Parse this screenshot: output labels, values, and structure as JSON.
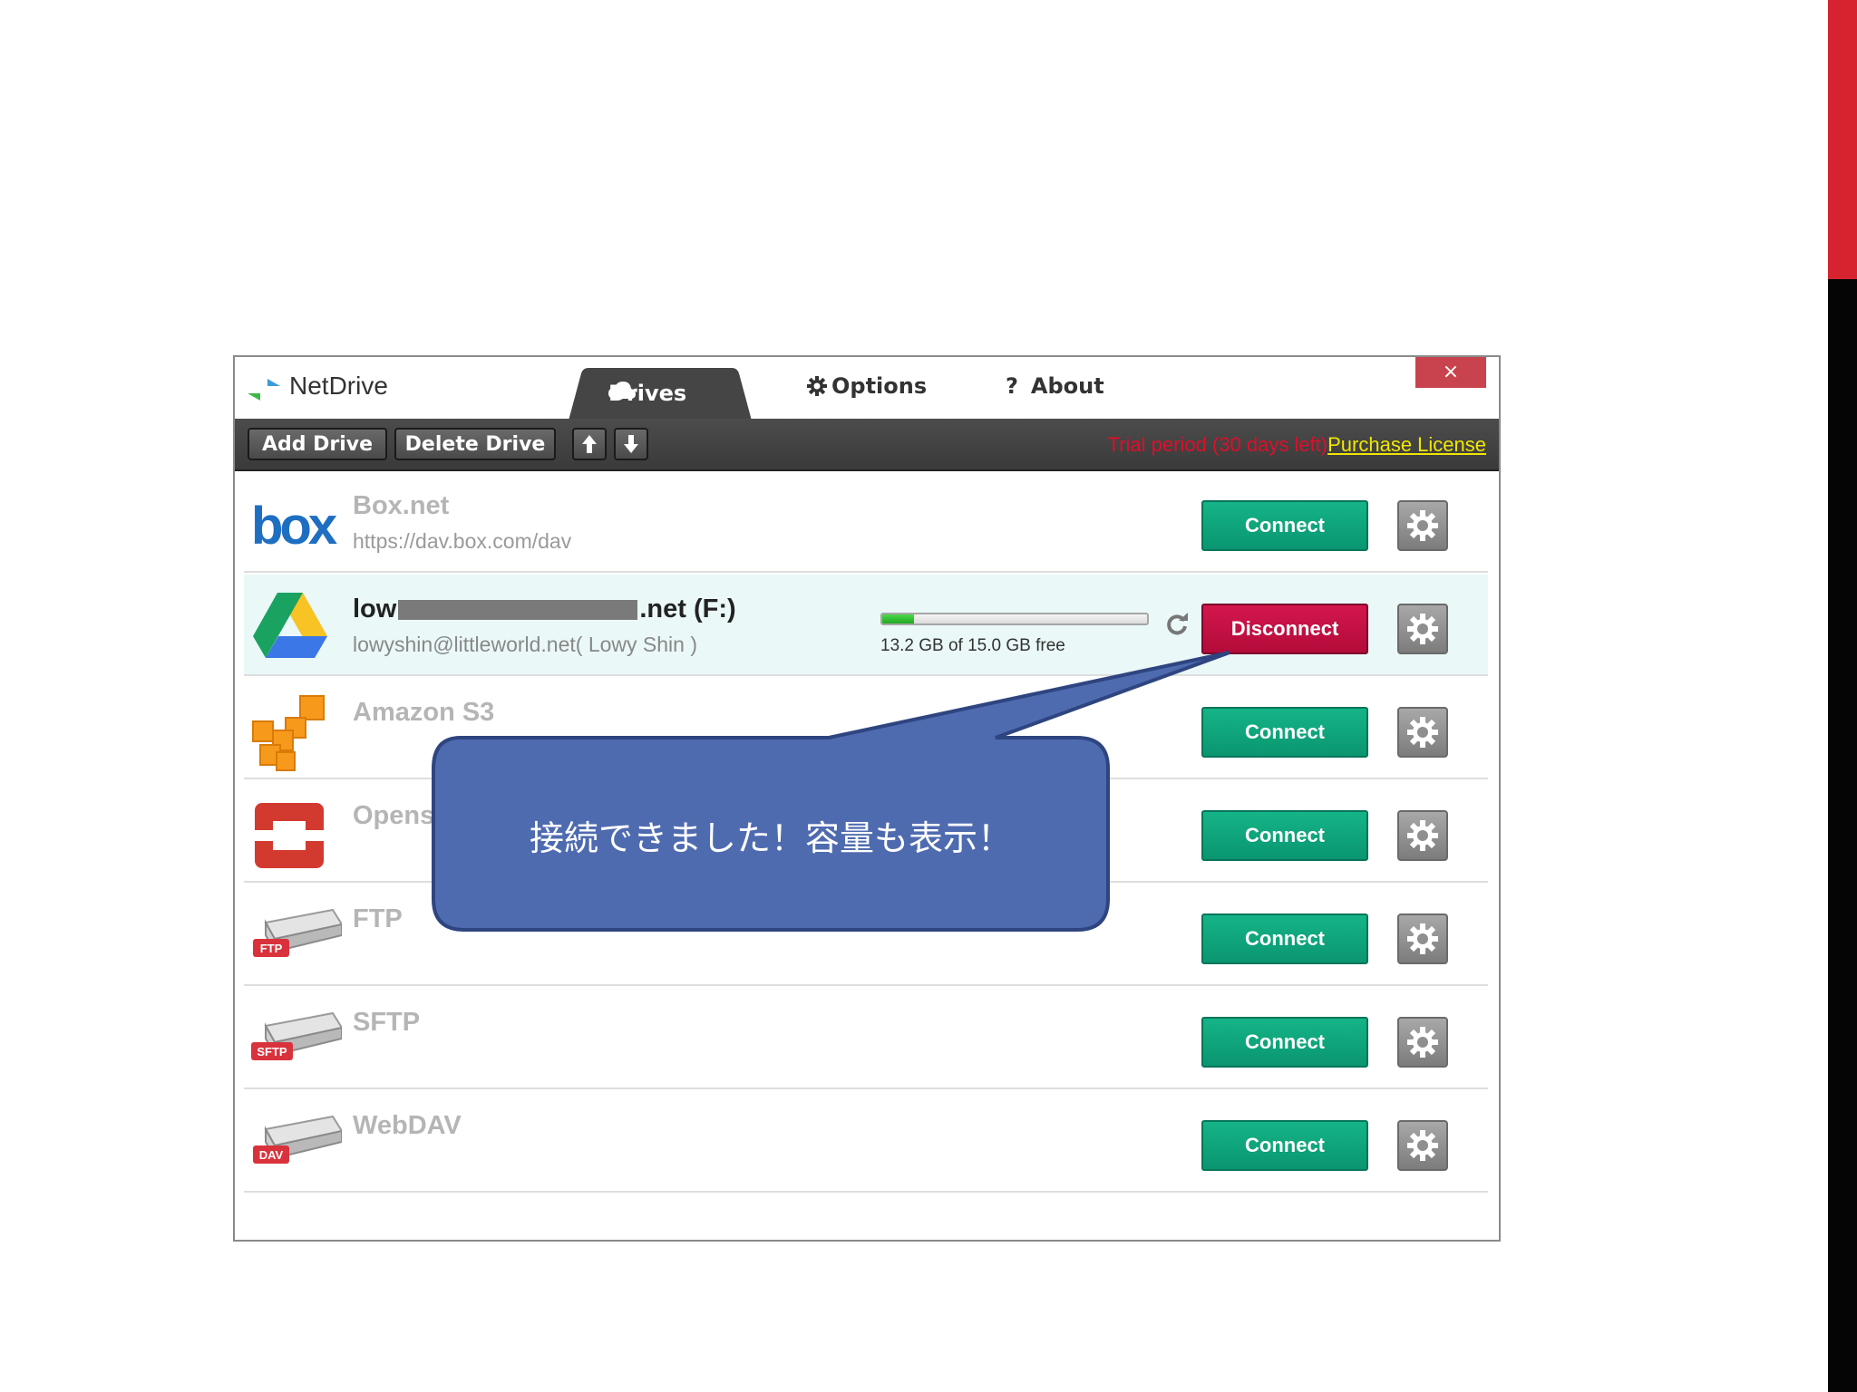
{
  "window": {
    "app_title": "NetDrive",
    "close_label": "×"
  },
  "tabs": {
    "drives": "Drives",
    "options": "Options",
    "about": "About"
  },
  "toolbar": {
    "add_drive": "Add Drive",
    "delete_drive": "Delete Drive",
    "trial_text": "Trial period (30 days left)",
    "purchase_link": "Purchase License"
  },
  "drives": [
    {
      "name": "Box.net",
      "url": "https://dav.box.com/dav",
      "action": "Connect",
      "icon": "box-logo-icon"
    },
    {
      "name_prefix": "low",
      "name_suffix": ".net (F:)",
      "url": "lowyshin@littleworld.net( Lowy Shin )",
      "action": "Disconnect",
      "icon": "google-drive-icon",
      "capacity": "13.2 GB of 15.0 GB free",
      "used_fraction": 0.12
    },
    {
      "name": "Amazon S3",
      "url": "",
      "action": "Connect",
      "icon": "amazon-s3-icon"
    },
    {
      "name": "Opens",
      "url": "",
      "action": "Connect",
      "icon": "openstack-icon"
    },
    {
      "name": "FTP",
      "url": "",
      "action": "Connect",
      "icon": "ftp-drive-icon",
      "badge": "FTP"
    },
    {
      "name": "SFTP",
      "url": "",
      "action": "Connect",
      "icon": "sftp-drive-icon",
      "badge": "SFTP"
    },
    {
      "name": "WebDAV",
      "url": "",
      "action": "Connect",
      "icon": "webdav-drive-icon",
      "badge": "DAV"
    }
  ],
  "callout": {
    "text": "接続できました！容量も表示！"
  },
  "colors": {
    "connect": "#0fa57b",
    "disconnect": "#c4103f",
    "callout_fill": "#4f6bb0",
    "trial_red": "#e10d2a",
    "purchase_yellow": "#f1e600",
    "side_red": "#d7232f"
  }
}
